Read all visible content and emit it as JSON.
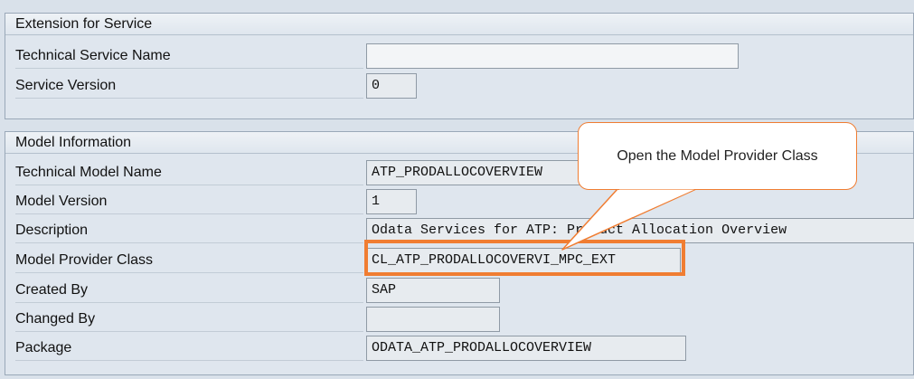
{
  "extension_group": {
    "title": "Extension for Service",
    "fields": [
      {
        "label": "Technical Service Name",
        "value": ""
      },
      {
        "label": "Service Version",
        "value": "0"
      }
    ]
  },
  "model_group": {
    "title": "Model Information",
    "fields": [
      {
        "label": "Technical Model Name",
        "value": "ATP_PRODALLOCOVERVIEW"
      },
      {
        "label": "Model Version",
        "value": "1"
      },
      {
        "label": "Description",
        "value": "Odata Services for ATP: Product Allocation Overview"
      },
      {
        "label": "Model Provider Class",
        "value": "CL_ATP_PRODALLOCOVERVI_MPC_EXT"
      },
      {
        "label": "Created By",
        "value": "SAP"
      },
      {
        "label": "Changed By",
        "value": ""
      },
      {
        "label": "Package",
        "value": "ODATA_ATP_PRODALLOCOVERVIEW"
      }
    ]
  },
  "callout": {
    "text": "Open the Model Provider Class"
  },
  "colors": {
    "highlight": "#f07d32",
    "background": "#d9e1ea"
  }
}
